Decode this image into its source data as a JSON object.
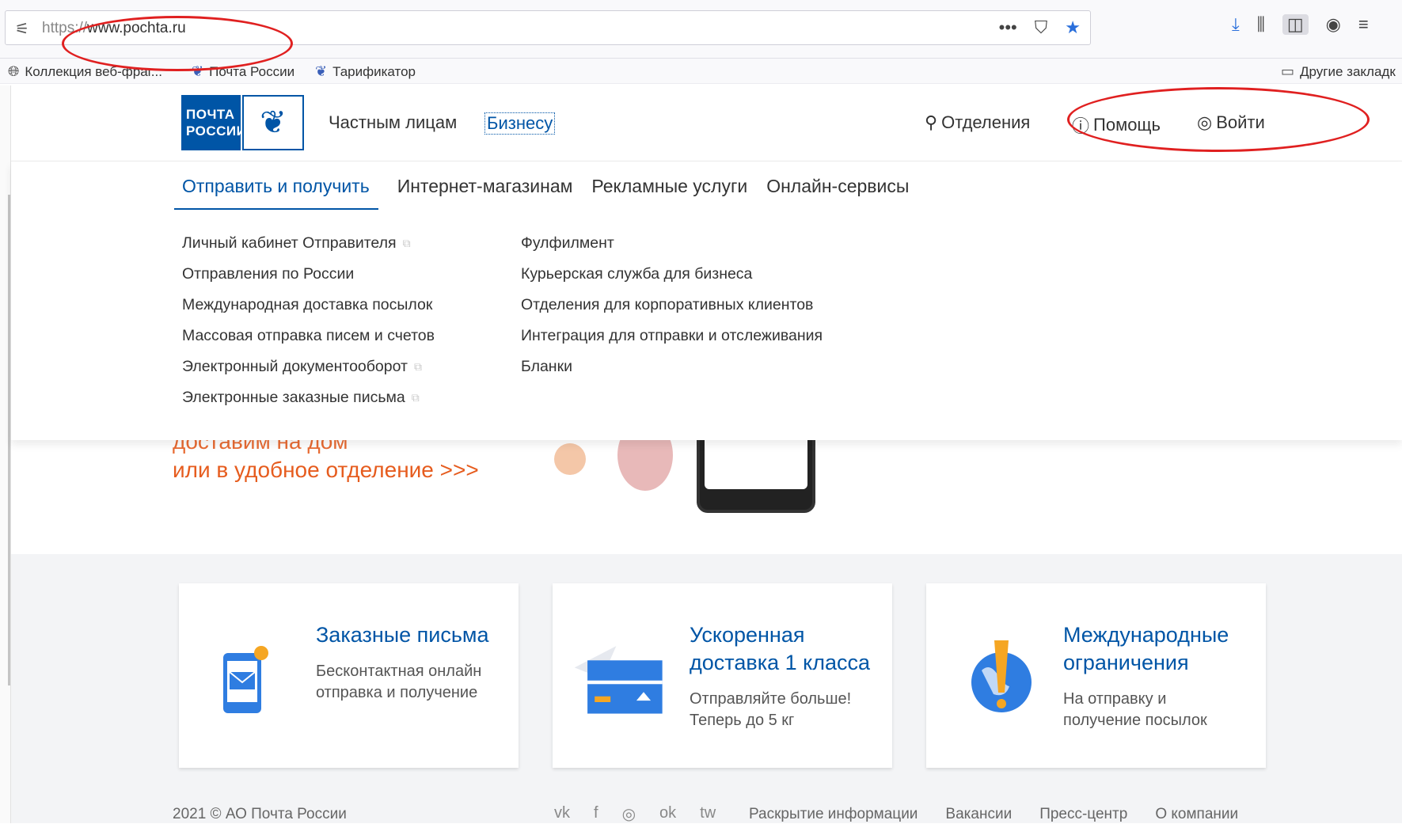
{
  "browser": {
    "url_protocol": "https://",
    "url_host": "www.pochta.ru",
    "url_actions": [
      "•••",
      "⛉",
      "★"
    ],
    "toolbar_icons": [
      "⤓",
      "⫼",
      "◫",
      "◉",
      "≡"
    ],
    "bookmarks": [
      {
        "label": "Коллекция веб-фраг...",
        "icon": "globe-icon"
      },
      {
        "label": "Почта России",
        "icon": "eagle-icon"
      },
      {
        "label": "Тарификатор",
        "icon": "eagle-icon"
      }
    ],
    "other_bookmarks": "Другие закладк"
  },
  "header": {
    "logo_line1": "ПОЧТА",
    "logo_line2": "РОССИИ",
    "nav_private": "Частным лицам",
    "nav_business": "Бизнесу",
    "offices": "Отделения",
    "help": "Помощь",
    "login": "Войти"
  },
  "mega_menu": {
    "tabs": [
      {
        "label": "Отправить и получить",
        "active": true
      },
      {
        "label": "Интернет-магазинам",
        "active": false
      },
      {
        "label": "Рекламные услуги",
        "active": false
      },
      {
        "label": "Онлайн-сервисы",
        "active": false
      }
    ],
    "col1": [
      {
        "label": "Личный кабинет Отправителя",
        "external": true
      },
      {
        "label": "Отправления по России",
        "external": false
      },
      {
        "label": "Международная доставка посылок",
        "external": false
      },
      {
        "label": "Массовая отправка писем и счетов",
        "external": false
      },
      {
        "label": "Электронный документооборот",
        "external": true
      },
      {
        "label": "Электронные заказные письма",
        "external": true
      }
    ],
    "col2": [
      {
        "label": "Фулфилмент",
        "external": false
      },
      {
        "label": "Курьерская служба для бизнеса",
        "external": false
      },
      {
        "label": "Отделения для корпоративных клиентов",
        "external": false
      },
      {
        "label": "Интеграция для отправки и отслеживания",
        "external": false
      },
      {
        "label": "Бланки",
        "external": false
      }
    ]
  },
  "banner": {
    "line1": "доставим на дом",
    "line2": "или в удобное отделение >>>"
  },
  "cards": [
    {
      "title1": "Заказные письма",
      "title2": "",
      "desc1": "Бесконтактная онлайн",
      "desc2": "отправка и получение"
    },
    {
      "title1": "Ускоренная",
      "title2": "доставка 1 класса",
      "desc1": "Отправляйте больше!",
      "desc2": "Теперь до 5 кг"
    },
    {
      "title1": "Международные",
      "title2": "ограничения",
      "desc1": "На отправку и",
      "desc2": "получение посылок"
    }
  ],
  "footer": {
    "copyright": "2021 © АО Почта России",
    "social": [
      "vk",
      "f",
      "◎",
      "ok",
      "tw"
    ],
    "links": [
      "Раскрытие информации",
      "Вакансии",
      "Пресс-центр",
      "О компании"
    ]
  },
  "colors": {
    "brand_blue": "#0055a6",
    "banner_orange": "#e65c1e",
    "annotation_red": "#e02020"
  }
}
